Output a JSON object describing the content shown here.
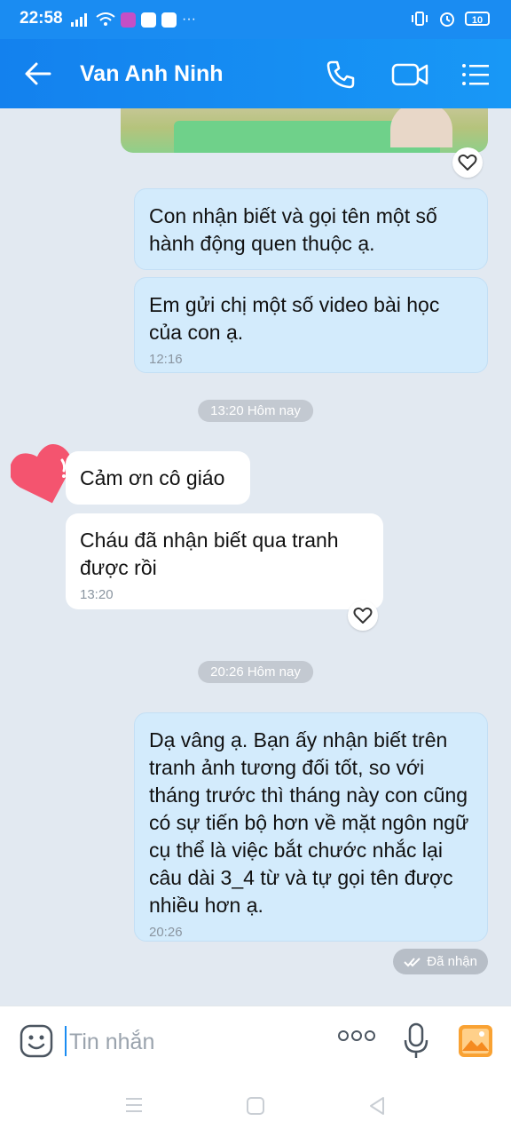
{
  "status_bar": {
    "time": "22:58",
    "more": "···",
    "battery": "10"
  },
  "header": {
    "contact_name": "Van Anh Ninh"
  },
  "messages": [
    {
      "id": "m1",
      "direction": "out",
      "text": "Con nhận biết và gọi tên một số hành động quen thuộc ạ."
    },
    {
      "id": "m2",
      "direction": "out",
      "text": "Em gửi chị một số video bài học của con ạ.",
      "time": "12:16"
    },
    {
      "id": "m3",
      "direction": "in",
      "text": "Cảm ơn cô giáo"
    },
    {
      "id": "m4",
      "direction": "in",
      "text": "Cháu đã nhận biết qua tranh được rồi",
      "time": "13:20"
    },
    {
      "id": "m5",
      "direction": "out",
      "text": "Dạ vâng ạ. Bạn ấy nhận biết trên tranh ảnh tương đối tốt,  so với tháng trước thì tháng này con cũng có sự tiến bộ hơn về mặt ngôn ngữ cụ thể là việc bắt chước nhắc lại câu dài 3_4 từ và tự gọi tên được nhiều hơn ạ.",
      "time": "20:26"
    }
  ],
  "date_separators": [
    "13:20 Hôm nay",
    "20:26 Hôm nay"
  ],
  "delivery_status": "Đã nhận",
  "composer": {
    "placeholder": "Tin nhắn"
  },
  "colors": {
    "header": "#1a8cf2",
    "outgoing_bubble": "#d3ebfc",
    "incoming_bubble": "#ffffff",
    "chat_background": "#e2e9f1",
    "heart_reaction": "#f4546f"
  }
}
